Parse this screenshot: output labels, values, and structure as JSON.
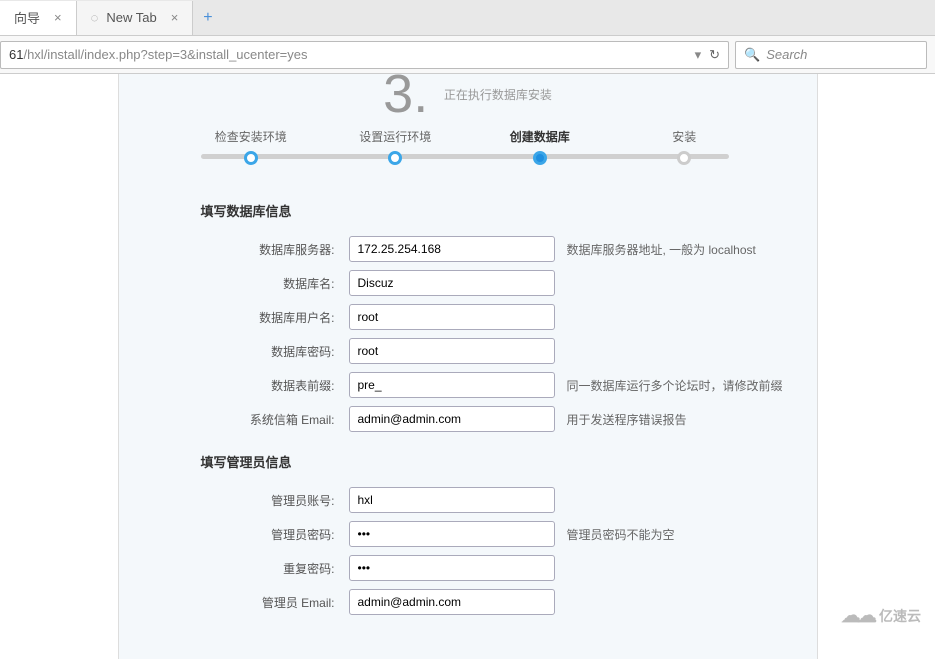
{
  "browser": {
    "tabs": [
      {
        "title": "向导",
        "showClose": true
      },
      {
        "title": "New Tab",
        "showClose": true
      }
    ],
    "url_prefix": "61",
    "url_path": "/hxl/install/index.php?step=3&install_ucenter=yes",
    "search_placeholder": "Search"
  },
  "installer": {
    "step_number": "3.",
    "step_subtitle": "正在执行数据库安装",
    "steps": [
      {
        "label": "检查安装环境",
        "active": false
      },
      {
        "label": "设置运行环境",
        "active": false
      },
      {
        "label": "创建数据库",
        "active": true
      },
      {
        "label": "安装",
        "active": false
      }
    ],
    "sections": {
      "db": {
        "title": "填写数据库信息",
        "rows": [
          {
            "label": "数据库服务器:",
            "value": "172.25.254.168",
            "hint": "数据库服务器地址, 一般为 localhost"
          },
          {
            "label": "数据库名:",
            "value": "Discuz",
            "hint": ""
          },
          {
            "label": "数据库用户名:",
            "value": "root",
            "hint": ""
          },
          {
            "label": "数据库密码:",
            "value": "root",
            "hint": ""
          },
          {
            "label": "数据表前缀:",
            "value": "pre_",
            "hint": "同一数据库运行多个论坛时，请修改前缀"
          },
          {
            "label": "系统信箱 Email:",
            "value": "admin@admin.com",
            "hint": "用于发送程序错误报告"
          }
        ]
      },
      "admin": {
        "title": "填写管理员信息",
        "rows": [
          {
            "label": "管理员账号:",
            "value": "hxl",
            "hint": "",
            "type": "text"
          },
          {
            "label": "管理员密码:",
            "value": "•••",
            "hint": "管理员密码不能为空",
            "type": "password"
          },
          {
            "label": "重复密码:",
            "value": "•••",
            "hint": "",
            "type": "password"
          },
          {
            "label": "管理员 Email:",
            "value": "admin@admin.com",
            "hint": "",
            "type": "text"
          }
        ]
      }
    }
  },
  "watermark": "亿速云"
}
